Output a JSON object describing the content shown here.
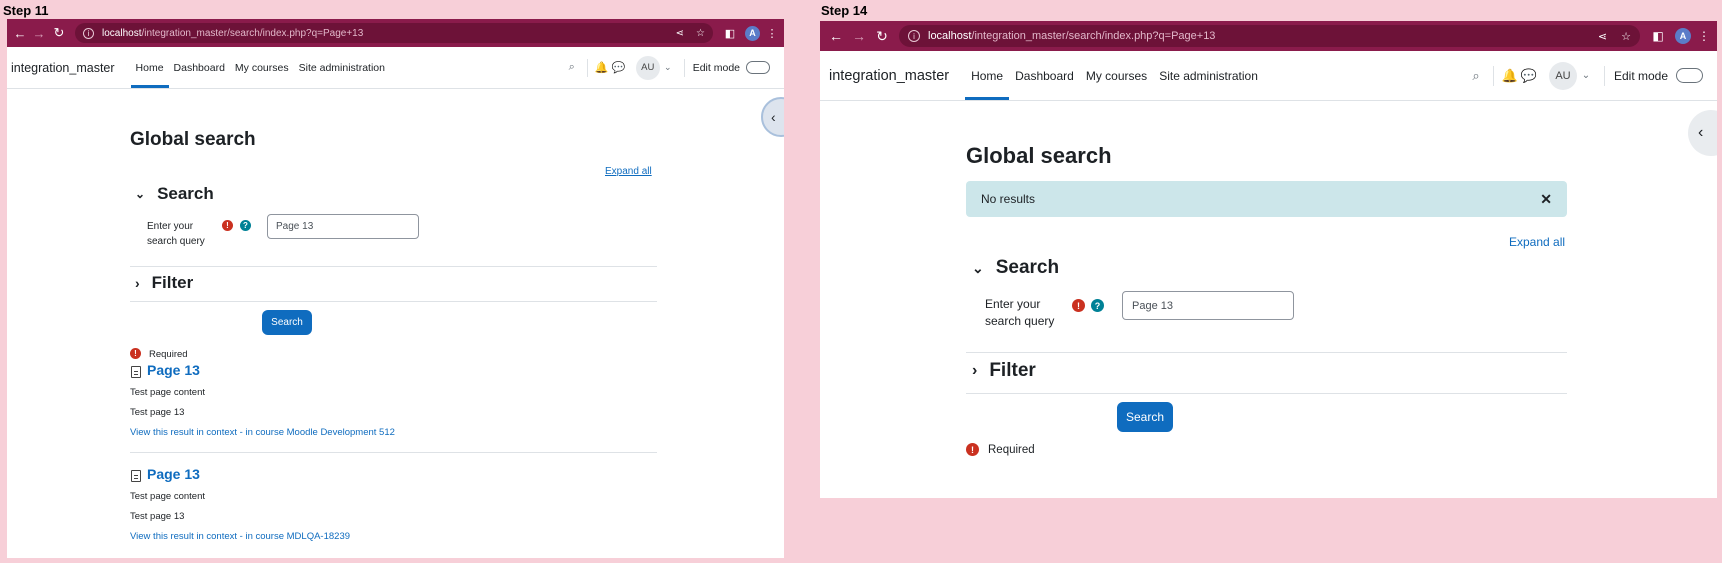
{
  "left": {
    "step": "Step 11",
    "browser": {
      "url_host": "localhost",
      "url_path": "/integration_master/search/index.php?q=Page+13",
      "profile": "A"
    },
    "navbar": {
      "brand": "integration_master",
      "links": [
        "Home",
        "Dashboard",
        "My courses",
        "Site administration"
      ],
      "avatar": "AU",
      "edit_mode": "Edit mode"
    },
    "page": {
      "title": "Global search",
      "expand_all": "Expand all",
      "search_section": "Search",
      "query_label_1": "Enter your",
      "query_label_2": "search query",
      "query_value": "Page 13",
      "filter_section": "Filter",
      "search_button": "Search",
      "required": "Required"
    },
    "results": [
      {
        "title": "Page 13",
        "line1": "Test page content",
        "line2": "Test page 13",
        "link_prefix": "View this result in context",
        "link_course": " - in course Moodle Development 512"
      },
      {
        "title": "Page 13",
        "line1": "Test page content",
        "line2": "Test page 13",
        "link_prefix": "View this result in context",
        "link_course": " - in course MDLQA-18239"
      }
    ]
  },
  "right": {
    "step": "Step 14",
    "browser": {
      "url_host": "localhost",
      "url_path": "/integration_master/search/index.php?q=Page+13",
      "profile": "A"
    },
    "navbar": {
      "brand": "integration_master",
      "links": [
        "Home",
        "Dashboard",
        "My courses",
        "Site administration"
      ],
      "avatar": "AU",
      "edit_mode": "Edit mode"
    },
    "page": {
      "title": "Global search",
      "alert": "No results",
      "expand_all": "Expand all",
      "search_section": "Search",
      "query_label_1": "Enter your",
      "query_label_2": "search query",
      "query_value": "Page 13",
      "filter_section": "Filter",
      "search_button": "Search",
      "required": "Required"
    }
  }
}
